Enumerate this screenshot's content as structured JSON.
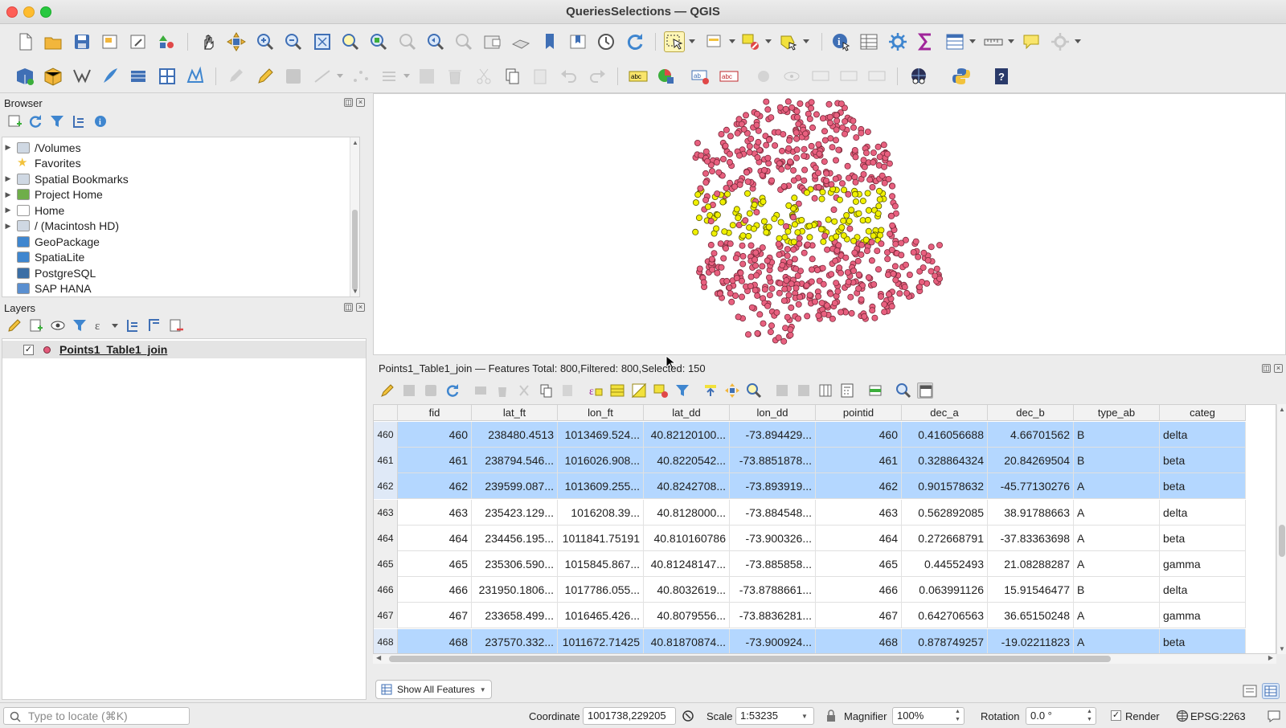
{
  "window": {
    "title": "QueriesSelections — QGIS"
  },
  "browser": {
    "title": "Browser",
    "items": [
      {
        "label": "/Volumes",
        "icon": "folder-icon",
        "expandable": true
      },
      {
        "label": "Favorites",
        "icon": "star-icon",
        "expandable": false
      },
      {
        "label": "Spatial Bookmarks",
        "icon": "bookmark-folder-icon",
        "expandable": true
      },
      {
        "label": "Project Home",
        "icon": "project-folder-icon",
        "expandable": true
      },
      {
        "label": "Home",
        "icon": "home-icon",
        "expandable": true
      },
      {
        "label": "/ (Macintosh HD)",
        "icon": "folder-icon",
        "expandable": true
      },
      {
        "label": "GeoPackage",
        "icon": "geopackage-icon",
        "expandable": false
      },
      {
        "label": "SpatiaLite",
        "icon": "spatialite-icon",
        "expandable": false
      },
      {
        "label": "PostgreSQL",
        "icon": "postgresql-icon",
        "expandable": false
      },
      {
        "label": "SAP HANA",
        "icon": "sap-hana-icon",
        "expandable": false
      }
    ]
  },
  "layers": {
    "title": "Layers",
    "items": [
      {
        "label": "Points1_Table1_join",
        "checked": true,
        "color": "#e35a7a"
      }
    ]
  },
  "map": {
    "point_color": "#e8607f",
    "selected_color": "#f0f000"
  },
  "attribute_table": {
    "summary": "Points1_Table1_join — Features Total: 800,Filtered: 800,Selected: 150",
    "columns": [
      "fid",
      "lat_ft",
      "lon_ft",
      "lat_dd",
      "lon_dd",
      "pointid",
      "dec_a",
      "dec_b",
      "type_ab",
      "categ"
    ],
    "rows": [
      {
        "head": "460",
        "selected": true,
        "cells": [
          "460",
          "238480.4513",
          "1013469.524...",
          "40.82120100...",
          "-73.894429...",
          "460",
          "0.416056688",
          "4.66701562",
          "B",
          "delta"
        ]
      },
      {
        "head": "461",
        "selected": true,
        "cells": [
          "461",
          "238794.546...",
          "1016026.908...",
          "40.8220542...",
          "-73.8851878...",
          "461",
          "0.328864324",
          "20.84269504",
          "B",
          "beta"
        ]
      },
      {
        "head": "462",
        "selected": true,
        "cells": [
          "462",
          "239599.087...",
          "1013609.255...",
          "40.8242708...",
          "-73.893919...",
          "462",
          "0.901578632",
          "-45.77130276",
          "A",
          "beta"
        ]
      },
      {
        "head": "463",
        "selected": false,
        "cells": [
          "463",
          "235423.129...",
          "1016208.39...",
          "40.8128000...",
          "-73.884548...",
          "463",
          "0.562892085",
          "38.91788663",
          "A",
          "delta"
        ]
      },
      {
        "head": "464",
        "selected": false,
        "cells": [
          "464",
          "234456.195...",
          "1011841.75191",
          "40.810160786",
          "-73.900326...",
          "464",
          "0.272668791",
          "-37.83363698",
          "A",
          "beta"
        ]
      },
      {
        "head": "465",
        "selected": false,
        "cells": [
          "465",
          "235306.590...",
          "1015845.867...",
          "40.81248147...",
          "-73.885858...",
          "465",
          "0.44552493",
          "21.08288287",
          "A",
          "gamma"
        ]
      },
      {
        "head": "466",
        "selected": false,
        "cells": [
          "466",
          "231950.1806...",
          "1017786.055...",
          "40.8032619...",
          "-73.8788661...",
          "466",
          "0.063991126",
          "15.91546477",
          "B",
          "delta"
        ]
      },
      {
        "head": "467",
        "selected": false,
        "cells": [
          "467",
          "233658.499...",
          "1016465.426...",
          "40.8079556...",
          "-73.8836281...",
          "467",
          "0.642706563",
          "36.65150248",
          "A",
          "gamma"
        ]
      },
      {
        "head": "468",
        "selected": true,
        "cells": [
          "468",
          "237570.332...",
          "1011672.71425",
          "40.81870874...",
          "-73.900924...",
          "468",
          "0.878749257",
          "-19.02211823",
          "A",
          "beta"
        ]
      }
    ],
    "show_all_label": "Show All Features"
  },
  "statusbar": {
    "locator_placeholder": "Type to locate (⌘K)",
    "coordinate_label": "Coordinate",
    "coordinate_value": "1001738,229205",
    "scale_label": "Scale",
    "scale_value": "1:53235",
    "magnifier_label": "Magnifier",
    "magnifier_value": "100%",
    "rotation_label": "Rotation",
    "rotation_value": "0.0 °",
    "render_label": "Render",
    "crs_label": "EPSG:2263"
  }
}
